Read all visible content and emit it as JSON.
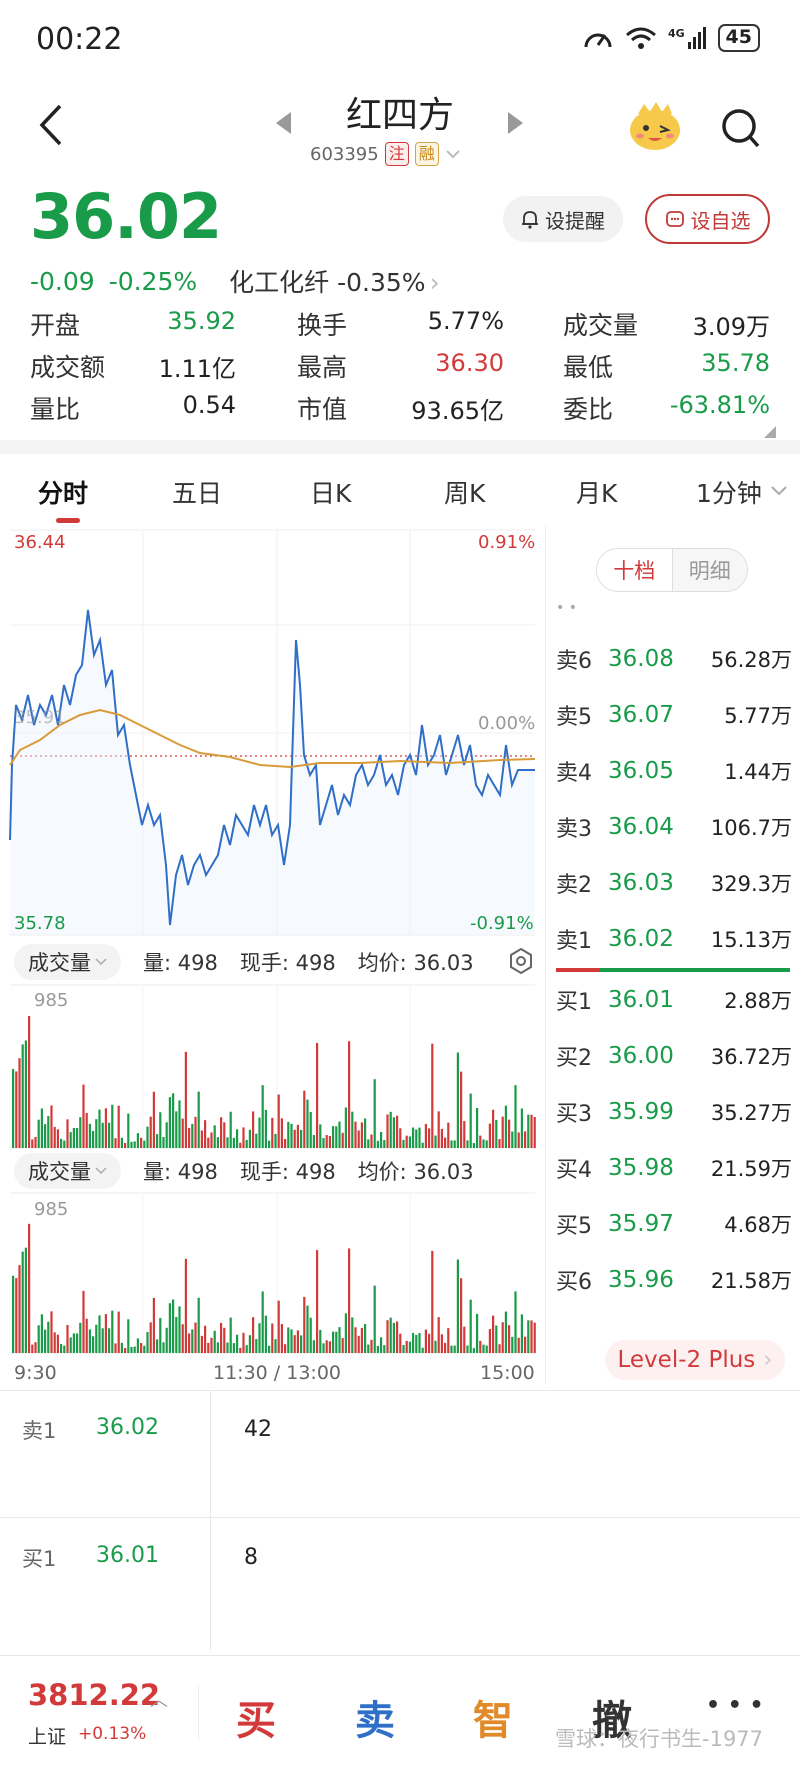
{
  "status": {
    "time": "00:22",
    "battery": "45"
  },
  "header": {
    "title": "红四方",
    "code": "603395",
    "tag_zhu": "注",
    "tag_rong": "融"
  },
  "price": {
    "last": "36.02",
    "change": "-0.09",
    "change_pct": "-0.25%",
    "sector": "化工化纤",
    "sector_pct": "-0.35%",
    "remind_label": "设提醒",
    "fav_label": "设自选"
  },
  "stats": [
    {
      "label": "开盘",
      "value": "35.92",
      "color": "green"
    },
    {
      "label": "换手",
      "value": "5.77%",
      "color": "dark"
    },
    {
      "label": "成交量",
      "value": "3.09万",
      "color": "dark"
    },
    {
      "label": "成交额",
      "value": "1.11亿",
      "color": "dark"
    },
    {
      "label": "最高",
      "value": "36.30",
      "color": "red"
    },
    {
      "label": "最低",
      "value": "35.78",
      "color": "green"
    },
    {
      "label": "量比",
      "value": "0.54",
      "color": "dark"
    },
    {
      "label": "市值",
      "value": "93.65亿",
      "color": "dark"
    },
    {
      "label": "委比",
      "value": "-63.81%",
      "color": "green"
    }
  ],
  "tabs": [
    "分时",
    "五日",
    "日K",
    "周K",
    "月K",
    "1分钟"
  ],
  "chart": {
    "price_high": "36.44",
    "price_low": "35.78",
    "pct_high": "0.91%",
    "pct_low": "-0.91%",
    "pct_zero": "0.00%",
    "mid_partial": "35.91",
    "vol_max": "985",
    "time_start": "9:30",
    "time_mid": "11:30 / 13:00",
    "time_end": "15:00"
  },
  "indicator": {
    "name": "成交量",
    "vol_label": "量: 498",
    "hand_label": "现手: 498",
    "avg_label": "均价: 36.03"
  },
  "depth": {
    "toggle_ten": "十档",
    "toggle_detail": "明细",
    "asks": [
      {
        "label": "卖6",
        "price": "36.08",
        "vol": "56.28万"
      },
      {
        "label": "卖5",
        "price": "36.07",
        "vol": "5.77万"
      },
      {
        "label": "卖4",
        "price": "36.05",
        "vol": "1.44万"
      },
      {
        "label": "卖3",
        "price": "36.04",
        "vol": "106.7万"
      },
      {
        "label": "卖2",
        "price": "36.03",
        "vol": "329.3万"
      },
      {
        "label": "卖1",
        "price": "36.02",
        "vol": "15.13万"
      }
    ],
    "bids": [
      {
        "label": "买1",
        "price": "36.01",
        "vol": "2.88万"
      },
      {
        "label": "买2",
        "price": "36.00",
        "vol": "36.72万"
      },
      {
        "label": "买3",
        "price": "35.99",
        "vol": "35.27万"
      },
      {
        "label": "买4",
        "price": "35.98",
        "vol": "21.59万"
      },
      {
        "label": "买5",
        "price": "35.97",
        "vol": "4.68万"
      },
      {
        "label": "买6",
        "price": "35.96",
        "vol": "21.58万"
      }
    ],
    "level2": "Level-2 Plus"
  },
  "orders": [
    {
      "label": "卖1",
      "price": "36.02",
      "qty": "42"
    },
    {
      "label": "买1",
      "price": "36.01",
      "qty": "8"
    }
  ],
  "bottom": {
    "index_value": "3812.22",
    "index_name": "上证",
    "index_change": "+0.13%",
    "buy": "买",
    "sell": "卖",
    "smart": "智",
    "cancel": "撤",
    "more": "• • •",
    "watermark": "雪球：夜行书生-1977"
  },
  "colors": {
    "up": "#d23a3a",
    "down": "#1a9b4a",
    "price_line": "#2f6fc7",
    "avg_line": "#d99a3a"
  }
}
